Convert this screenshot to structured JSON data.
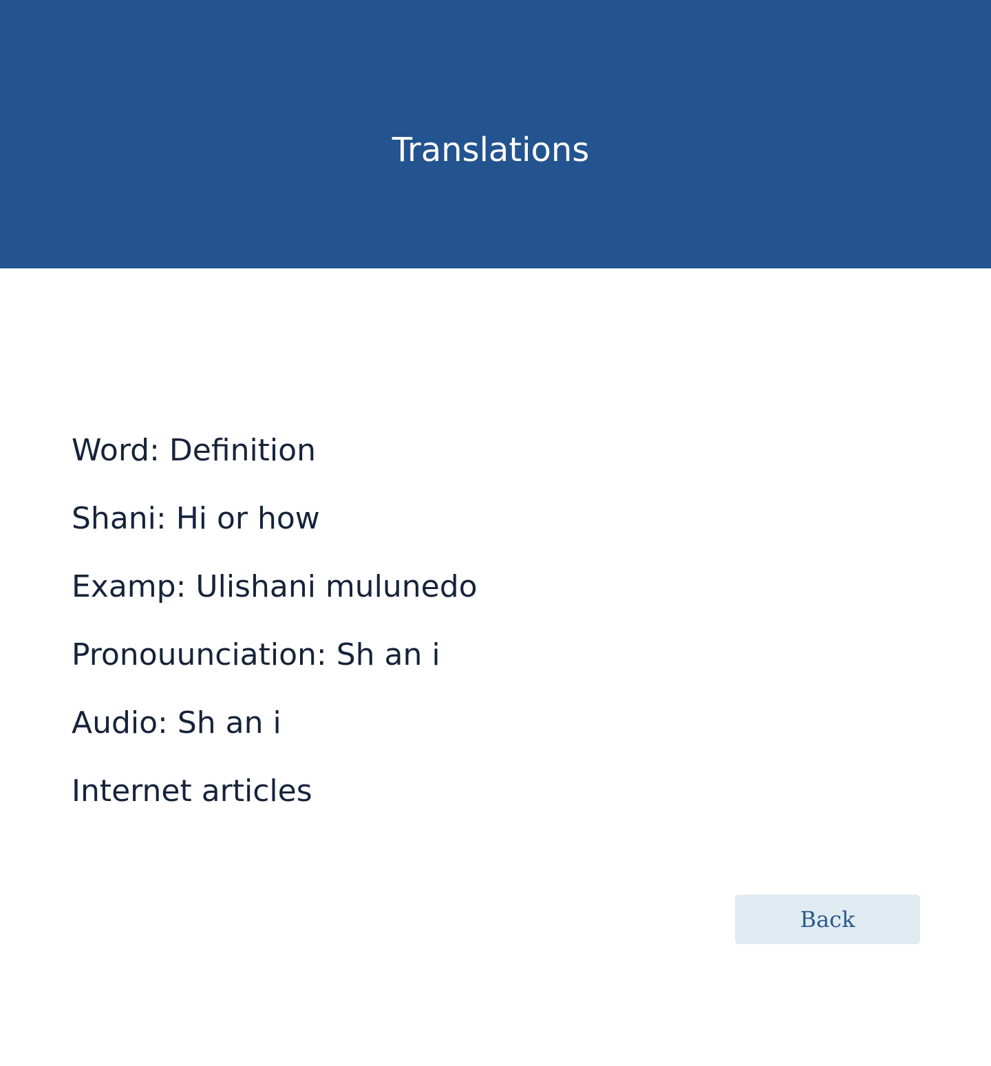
{
  "header": {
    "title": "Translations"
  },
  "entry": {
    "lines": [
      "Word: Definition",
      "Shani: Hi or how",
      "Examp: Ulishani mulunedo",
      "Pronouunciation: Sh an i",
      "Audio: Sh an i",
      "Internet articles"
    ]
  },
  "actions": {
    "back_label": "Back"
  },
  "colors": {
    "header_bg": "#23548f",
    "header_text": "#ffffff",
    "body_text": "#16233a",
    "button_bg": "#e0ebf2",
    "button_text": "#2c5a8c"
  }
}
